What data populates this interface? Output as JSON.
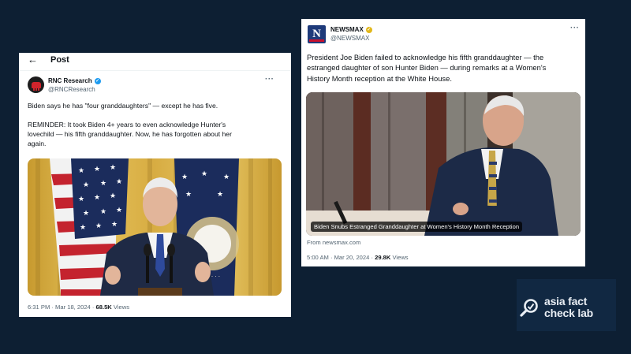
{
  "colors": {
    "background": "#0d1f33",
    "card": "#ffffff",
    "verified_blue": "#1d9bf0",
    "verified_gold": "#e2b719",
    "newsmax_blue": "#1e3a7a",
    "logo_bg": "#112842"
  },
  "left_post": {
    "back_icon": "arrow-left-icon",
    "header_title": "Post",
    "author_name": "RNC Research",
    "author_handle": "@RNCResearch",
    "more_icon": "more-horizontal-icon",
    "text_p1": "Biden says he has \"four granddaughters\" — except he has five.",
    "text_p2_line1": "REMINDER: It took Biden 4+ years to even acknowledge Hunter's",
    "text_p2_line2": "lovechild — his fifth granddaughter. Now, he has forgotten about her",
    "text_p2_line3": "again.",
    "time": "6:31 PM · Mar 18, 2024 · ",
    "views_count": "68.5K",
    "views_label": " Views"
  },
  "right_post": {
    "author_name": "NEWSMAX",
    "author_handle": "@NEWSMAX",
    "avatar_letter": "N",
    "more_icon": "more-horizontal-icon",
    "text_line1": "President Joe Biden failed to acknowledge his fifth granddaughter — the",
    "text_line2": "estranged daughter of son Hunter Biden — during remarks at a Women's",
    "text_line3": "History Month reception at the White House.",
    "media_caption": "Biden Snubs Estranged Granddaughter at Women's History Month Reception",
    "link_source": "From newsmax.com",
    "time": "5:00 AM · Mar 20, 2024 · ",
    "views_count": "29.8K",
    "views_label": " Views"
  },
  "logo": {
    "line1": "asia fact",
    "line2": "check lab"
  }
}
